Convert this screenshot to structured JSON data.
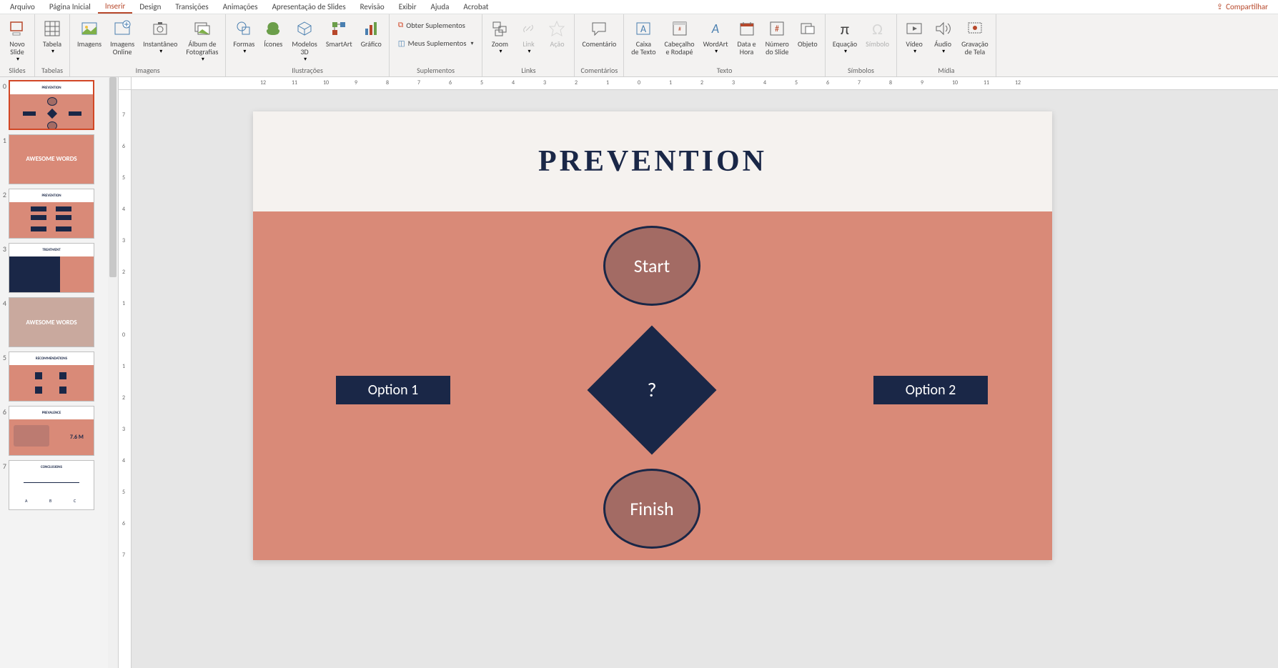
{
  "menu": {
    "items": [
      "Arquivo",
      "Página Inicial",
      "Inserir",
      "Design",
      "Transições",
      "Animações",
      "Apresentação de Slides",
      "Revisão",
      "Exibir",
      "Ajuda",
      "Acrobat"
    ],
    "active_index": 2,
    "share": "Compartilhar"
  },
  "ribbon": {
    "groups": {
      "slides": {
        "label": "Slides",
        "new_slide": "Novo\nSlide"
      },
      "tabelas": {
        "label": "Tabelas",
        "tabela": "Tabela"
      },
      "imagens": {
        "label": "Imagens",
        "imagens": "Imagens",
        "imagens_online": "Imagens\nOnline",
        "instantaneo": "Instantâneo",
        "album": "Álbum de\nFotografias"
      },
      "ilustracoes": {
        "label": "Ilustrações",
        "formas": "Formas",
        "icones": "Ícones",
        "modelos3d": "Modelos\n3D",
        "smartart": "SmartArt",
        "grafico": "Gráfico"
      },
      "suplementos": {
        "label": "Suplementos",
        "obter": "Obter Suplementos",
        "meus": "Meus Suplementos"
      },
      "links": {
        "label": "Links",
        "zoom": "Zoom",
        "link": "Link",
        "acao": "Ação"
      },
      "comentarios": {
        "label": "Comentários",
        "comentario": "Comentário"
      },
      "texto": {
        "label": "Texto",
        "caixa": "Caixa\nde Texto",
        "cabecalho": "Cabeçalho\ne Rodapé",
        "wordart": "WordArt",
        "datahora": "Data e\nHora",
        "numero": "Número\ndo Slide",
        "objeto": "Objeto"
      },
      "simbolos": {
        "label": "Símbolos",
        "equacao": "Equação",
        "simbolo": "Símbolo"
      },
      "midia": {
        "label": "Mídia",
        "video": "Vídeo",
        "audio": "Áudio",
        "gravacao": "Gravação\nde Tela"
      }
    }
  },
  "thumbnails": {
    "numbers": [
      "0",
      "1",
      "2",
      "3",
      "4",
      "5",
      "6",
      "7"
    ],
    "titles": [
      "PREVENTION",
      "AWESOME WORDS",
      "PREVENTION",
      "TREATMENT",
      "AWESOME WORDS",
      "RECOMMENDATIONS",
      "PREVALENCE",
      "CONCLUSIONS"
    ],
    "prevalence_value": "7.6 M"
  },
  "ruler": {
    "h": [
      "12",
      "11",
      "10",
      "9",
      "8",
      "7",
      "6",
      "5",
      "4",
      "3",
      "2",
      "1",
      "0",
      "1",
      "2",
      "3",
      "4",
      "5",
      "6",
      "7",
      "8",
      "9",
      "10",
      "11",
      "12"
    ],
    "v": [
      "7",
      "6",
      "5",
      "4",
      "3",
      "2",
      "1",
      "0",
      "1",
      "2",
      "3",
      "4",
      "5",
      "6",
      "7"
    ]
  },
  "slide": {
    "title": "PREVENTION",
    "start": "Start",
    "finish": "Finish",
    "decision": "?",
    "option1": "Option 1",
    "option2": "Option 2"
  }
}
